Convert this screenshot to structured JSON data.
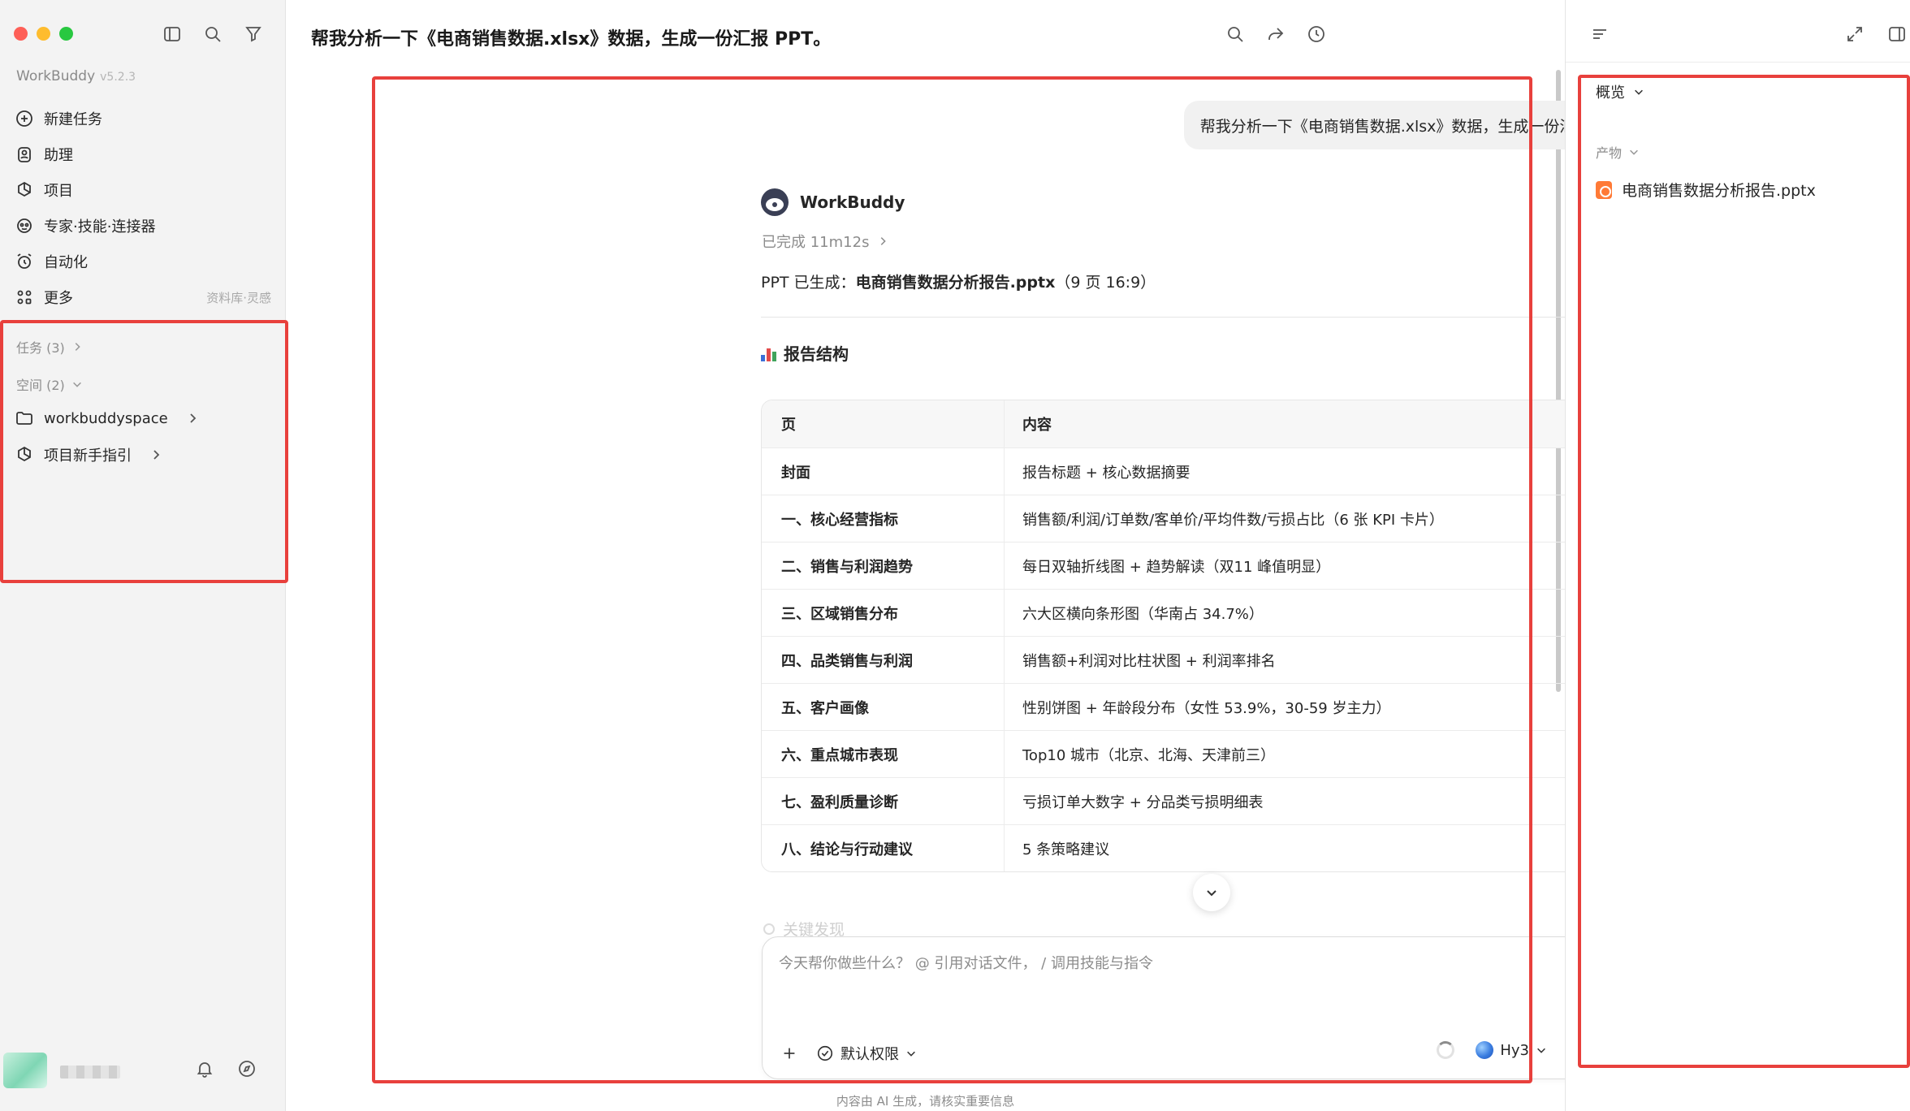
{
  "app": {
    "name": "WorkBuddy",
    "version": "v5.2.3"
  },
  "sidebar": {
    "nav": [
      {
        "label": "新建任务",
        "icon": "plus-circle-icon"
      },
      {
        "label": "助理",
        "icon": "assistant-icon"
      },
      {
        "label": "项目",
        "icon": "project-icon"
      },
      {
        "label": "专家·技能·连接器",
        "icon": "expert-icon"
      },
      {
        "label": "自动化",
        "icon": "alarm-icon"
      },
      {
        "label": "更多",
        "icon": "grid-icon",
        "extra": "资料库·灵感"
      }
    ],
    "tasks_label": "任务 (3)",
    "spaces_label": "空间 (2)",
    "spaces": [
      {
        "label": "workbuddyspace",
        "icon": "folder-icon"
      },
      {
        "label": "项目新手指引",
        "icon": "project-icon"
      }
    ]
  },
  "main": {
    "title": "帮我分析一下《电商销售数据.xlsx》数据，生成一份汇报 PPT。",
    "user_message": "帮我分析一下《电商销售数据.xlsx》数据，生成一份汇报 PPT。",
    "bot_name": "WorkBuddy",
    "status": "已完成 11m12s",
    "gen_prefix": "PPT 已生成：",
    "gen_file": "电商销售数据分析报告.pptx",
    "gen_suffix": "（9 页 16:9）",
    "section_title": "报告结构",
    "table": {
      "headers": [
        "页",
        "内容"
      ],
      "rows": [
        [
          "封面",
          "报告标题 + 核心数据摘要"
        ],
        [
          "一、核心经营指标",
          "销售额/利润/订单数/客单价/平均件数/亏损占比（6 张 KPI 卡片）"
        ],
        [
          "二、销售与利润趋势",
          "每日双轴折线图 + 趋势解读（双11 峰值明显）"
        ],
        [
          "三、区域销售分布",
          "六大区横向条形图（华南占 34.7%）"
        ],
        [
          "四、品类销售与利润",
          "销售额+利润对比柱状图 + 利润率排名"
        ],
        [
          "五、客户画像",
          "性别饼图 + 年龄段分布（女性 53.9%，30-59 岁主力）"
        ],
        [
          "六、重点城市表现",
          "Top10 城市（北京、北海、天津前三）"
        ],
        [
          "七、盈利质量诊断",
          "亏损订单大数字 + 分品类亏损明细表"
        ],
        [
          "八、结论与行动建议",
          "5 条策略建议"
        ]
      ]
    },
    "faded_text": "关键发现",
    "composer": {
      "placeholder": "今天帮你做些什么？ @ 引用对话文件， / 调用技能与指令",
      "permission": "默认权限",
      "model": "Hy3"
    },
    "disclaimer": "内容由 AI 生成，请核实重要信息"
  },
  "rpanel": {
    "overview": "概览",
    "products": "产物",
    "file": "电商销售数据分析报告.pptx"
  },
  "colors": {
    "highlight": "#e8403c",
    "send_button": "#8f8f8f",
    "ppt_icon": "#ff7a36"
  }
}
